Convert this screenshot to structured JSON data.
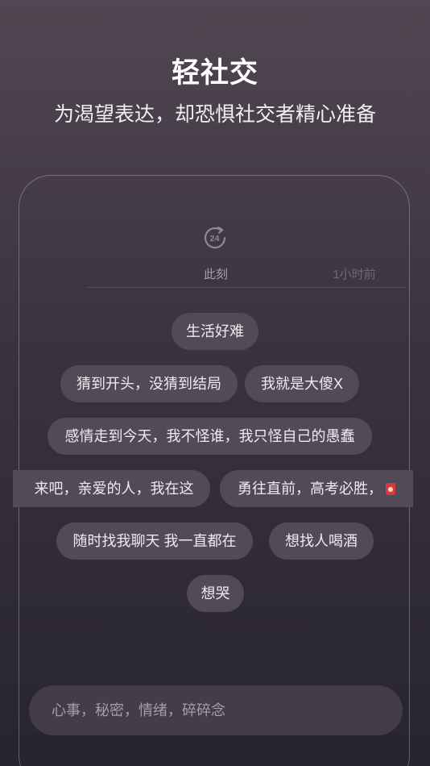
{
  "header": {
    "title": "轻社交",
    "subtitle": "为渴望表达，却恐惧社交者精心准备"
  },
  "tabs": {
    "timer_icon_text": "24",
    "now_label": "此刻",
    "hour_label": "1小时前"
  },
  "bubbles": [
    "生活好难",
    "猜到开头，没猜到结局",
    "我就是大傻X",
    "感情走到今天，我不怪谁，我只怪自己的愚蠢",
    "来吧，亲爱的人，我在这",
    "勇往直前，高考必胜，",
    "随时找我聊天 我一直都在",
    "想找人喝酒",
    "想哭"
  ],
  "input": {
    "placeholder": "心事，秘密，情绪，碎碎念"
  }
}
